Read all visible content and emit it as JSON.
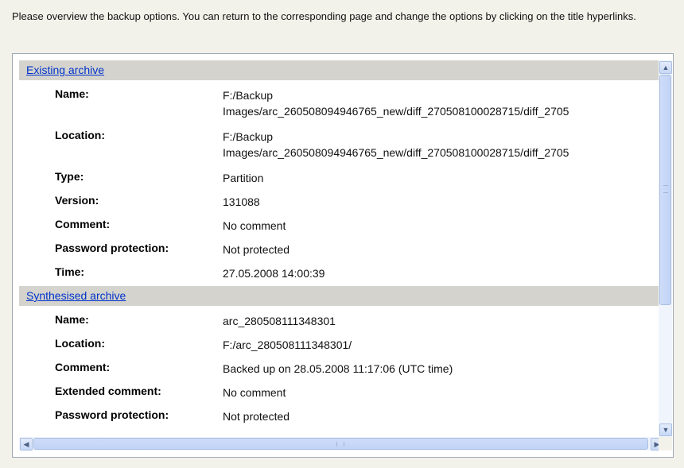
{
  "intro": "Please overview the backup options. You can return to the corresponding page and change the options by clicking on the title hyperlinks.",
  "existing": {
    "title": "Existing archive",
    "name_key": "Name:",
    "name_val": [
      "F:/Backup",
      "Images/arc_260508094946765_new/diff_270508100028715/diff_2705"
    ],
    "location_key": "Location:",
    "location_val": [
      "F:/Backup",
      "Images/arc_260508094946765_new/diff_270508100028715/diff_2705"
    ],
    "type_key": "Type:",
    "type_val": "Partition",
    "version_key": "Version:",
    "version_val": "131088",
    "comment_key": "Comment:",
    "comment_val": "No comment",
    "password_key": "Password protection:",
    "password_val": "Not protected",
    "time_key": "Time:",
    "time_val": "27.05.2008 14:00:39"
  },
  "synthesised": {
    "title": "Synthesised archive",
    "name_key": "Name:",
    "name_val": "arc_280508111348301",
    "location_key": "Location:",
    "location_val": "F:/arc_280508111348301/",
    "comment_key": "Comment:",
    "comment_val": "Backed up on 28.05.2008 11:17:06 (UTC time)",
    "ext_comment_key": "Extended comment:",
    "ext_comment_val": "No comment",
    "password_key": "Password protection:",
    "password_val": "Not protected"
  },
  "scrollbar": {
    "up": "▲",
    "down": "▼",
    "left": "◀",
    "right": "▶"
  }
}
